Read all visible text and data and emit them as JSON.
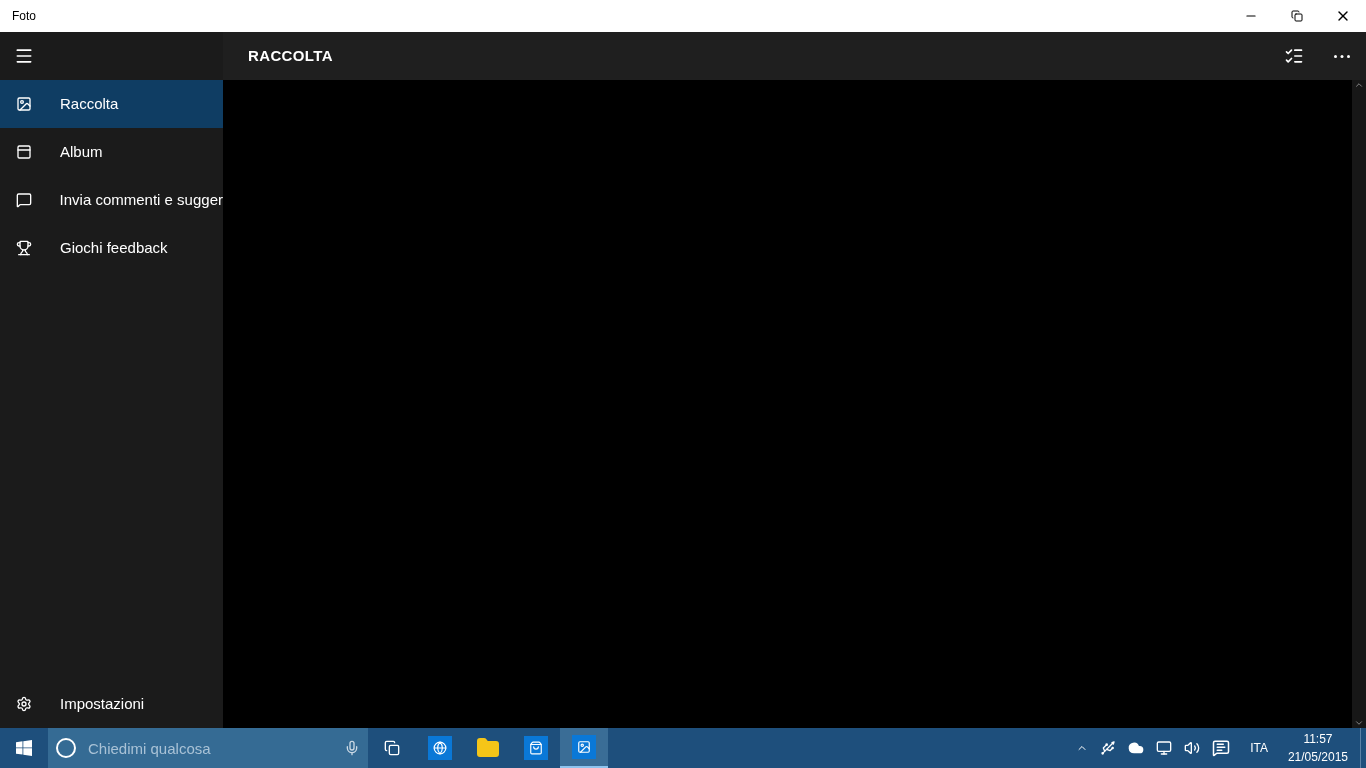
{
  "window": {
    "title": "Foto"
  },
  "header": {
    "title": "RACCOLTA"
  },
  "sidebar": {
    "items": [
      {
        "label": "Raccolta",
        "kind": "collection",
        "selected": true
      },
      {
        "label": "Album",
        "kind": "album",
        "selected": false
      },
      {
        "label": "Invia commenti e sugger",
        "kind": "feedback",
        "selected": false
      },
      {
        "label": "Giochi feedback",
        "kind": "games",
        "selected": false
      }
    ],
    "settings": {
      "label": "Impostazioni"
    }
  },
  "taskbar": {
    "search": {
      "placeholder": "Chiedimi qualcosa"
    },
    "apps": [
      {
        "kind": "browser",
        "selected": false
      },
      {
        "kind": "explorer",
        "selected": false
      },
      {
        "kind": "store",
        "selected": false
      },
      {
        "kind": "photos",
        "selected": true
      }
    ],
    "language": "ITA",
    "time": "11:57",
    "date": "21/05/2015"
  }
}
